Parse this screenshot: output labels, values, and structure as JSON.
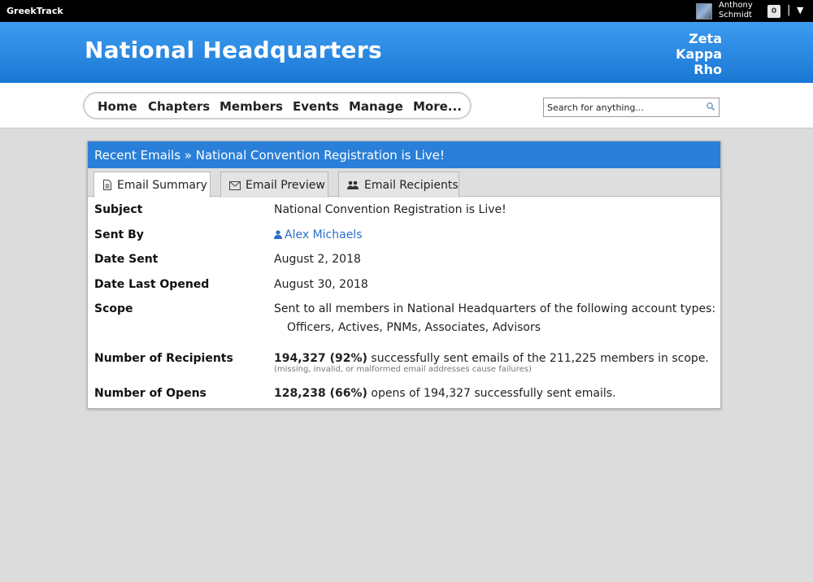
{
  "topbar": {
    "brand": "GreekTrack",
    "user_first": "Anthony",
    "user_last": "Schmidt",
    "notification_count": "0",
    "separator": "|"
  },
  "header": {
    "title": "National Headquarters",
    "org_line1": "Zeta",
    "org_line2": "Kappa",
    "org_line3": "Rho"
  },
  "nav": {
    "items": [
      "Home",
      "Chapters",
      "Members",
      "Events",
      "Manage",
      "More..."
    ]
  },
  "search": {
    "placeholder": "Search for anything..."
  },
  "panel": {
    "title": "Recent Emails » National Convention Registration is Live!",
    "tabs": [
      "Email Summary",
      "Email Preview",
      "Email Recipients"
    ],
    "active_tab": "Email Summary",
    "rows": {
      "subject_label": "Subject",
      "subject_value": "National Convention Registration is Live!",
      "sent_by_label": "Sent By",
      "sent_by_value": "Alex Michaels",
      "date_sent_label": "Date Sent",
      "date_sent_value": "August 2, 2018",
      "date_opened_label": "Date Last Opened",
      "date_opened_value": "August 30, 2018",
      "scope_label": "Scope",
      "scope_value": "Sent to all members in National Headquarters of the following account types:",
      "scope_types": "Officers, Actives, PNMs, Associates, Advisors",
      "recipients_label": "Number of Recipients",
      "recipients_count": "194,327 (92%)",
      "recipients_text": "successfully sent emails of the 211,225 members in scope.",
      "recipients_note": "(missing, invalid, or malformed email addresses cause failures)",
      "opens_label": "Number of Opens",
      "opens_count": "128,238 (66%)",
      "opens_text": "opens of 194,327 successfully sent emails."
    }
  },
  "colors": {
    "header_blue": "#1a78d4",
    "panel_blue": "#2a7fd8",
    "link_blue": "#2a6fc9"
  }
}
